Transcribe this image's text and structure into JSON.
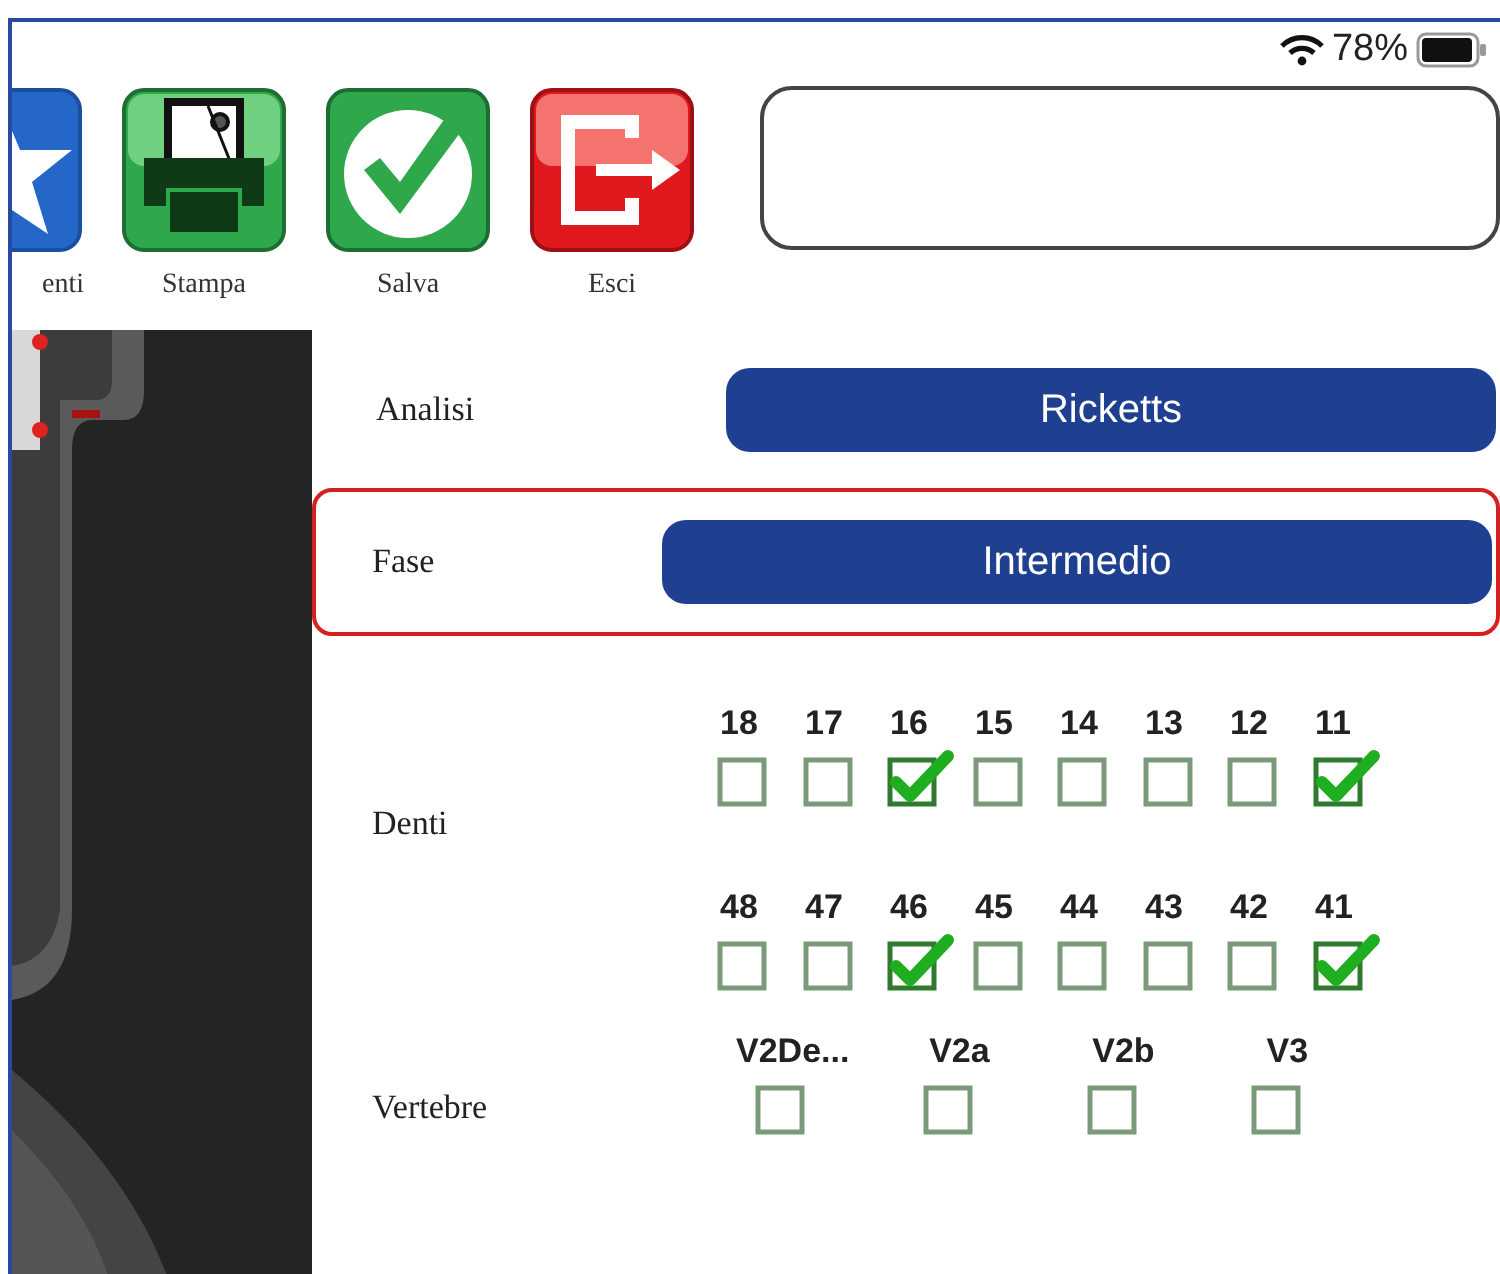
{
  "status_bar": {
    "battery": "78%"
  },
  "toolbar": [
    {
      "kind": "star",
      "label": "enti"
    },
    {
      "kind": "printer",
      "label": "Stampa"
    },
    {
      "kind": "check",
      "label": "Salva"
    },
    {
      "kind": "exit",
      "label": "Esci"
    }
  ],
  "note_field": {
    "kind": "field"
  },
  "analisi": {
    "label": "Analisi",
    "value": "Ricketts",
    "highlighted": false
  },
  "fase": {
    "label": "Fase",
    "value": "Intermedio",
    "highlighted": true
  },
  "denti": {
    "label": "Denti",
    "rows": [
      [
        {
          "number": "18",
          "checked": false
        },
        {
          "number": "17",
          "checked": false
        },
        {
          "number": "16",
          "checked": true
        },
        {
          "number": "15",
          "checked": false
        },
        {
          "number": "14",
          "checked": false
        },
        {
          "number": "13",
          "checked": false
        },
        {
          "number": "12",
          "checked": false
        },
        {
          "number": "11",
          "checked": true
        }
      ],
      [
        {
          "number": "48",
          "checked": false
        },
        {
          "number": "47",
          "checked": false
        },
        {
          "number": "46",
          "checked": true
        },
        {
          "number": "45",
          "checked": false
        },
        {
          "number": "44",
          "checked": false
        },
        {
          "number": "43",
          "checked": false
        },
        {
          "number": "42",
          "checked": false
        },
        {
          "number": "41",
          "checked": true
        }
      ]
    ]
  },
  "vertebre": {
    "label": "Vertebre",
    "items": [
      {
        "label": "V2De...",
        "checked": false
      },
      {
        "label": "V2a",
        "checked": false
      },
      {
        "label": "V2b",
        "checked": false
      },
      {
        "label": "V3",
        "checked": false
      }
    ]
  }
}
